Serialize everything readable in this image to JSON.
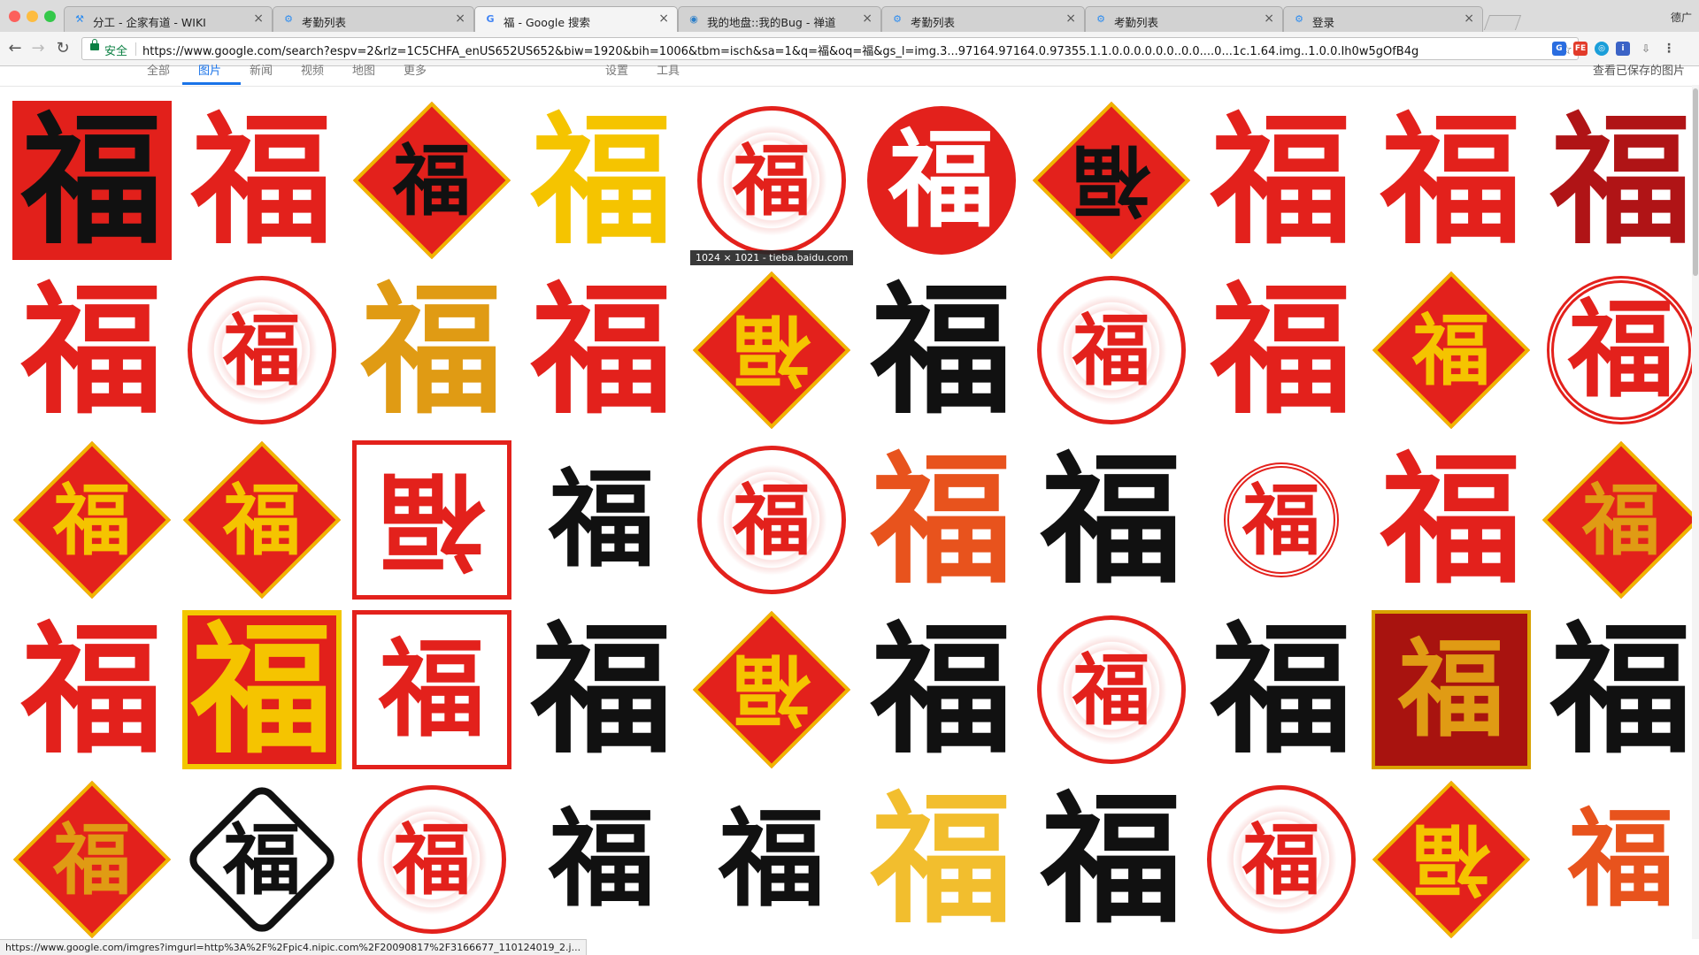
{
  "tabs": [
    {
      "label": "分工 - 企家有道 - WIKI",
      "icon": "wiki-icon",
      "icon_char": "⚒",
      "active": false
    },
    {
      "label": "考勤列表",
      "icon": "gear-icon",
      "icon_char": "⚙",
      "active": false
    },
    {
      "label": "福 - Google 搜索",
      "icon": "google-icon",
      "icon_char": "G",
      "active": true
    },
    {
      "label": "我的地盘::我的Bug - 禅道",
      "icon": "zentao-icon",
      "icon_char": "◉",
      "active": false
    },
    {
      "label": "考勤列表",
      "icon": "gear-icon",
      "icon_char": "⚙",
      "active": false
    },
    {
      "label": "考勤列表",
      "icon": "gear-icon",
      "icon_char": "⚙",
      "active": false
    },
    {
      "label": "登录",
      "icon": "gear-icon",
      "icon_char": "⚙",
      "active": false
    }
  ],
  "profile_label": "德广",
  "toolbar": {
    "back": "←",
    "forward": "→",
    "reload": "↻",
    "secure_label": "安全",
    "url": "https://www.google.com/search?espv=2&rlz=1C5CHFA_enUS652US652&biw=1920&bih=1006&tbm=isch&sa=1&q=福&oq=福&gs_l=img.3...97164.97164.0.97355.1.1.0.0.0.0.0.0..0.0....0...1c.1.64.img..1.0.0.Ih0w5gOfB4g",
    "star": "☆"
  },
  "google_nav": {
    "items": [
      "全部",
      "图片",
      "新闻",
      "视频",
      "地图",
      "更多",
      "设置",
      "工具"
    ],
    "active": "图片",
    "right_link": "查看已保存的图片"
  },
  "image_glyph": "福",
  "tooltip": "1024 × 1021 - tieba.baidu.com",
  "status_url": "https://www.google.com/imgres?imgurl=http%3A%2F%2Fpic4.nipic.com%2F20090817%2F3166677_110124019_2.j...",
  "colors": {
    "red": "#e3211c",
    "black": "#111111",
    "yellow": "#f5c400",
    "gold": "#e09b14",
    "orange": "#e8531d",
    "link_blue": "#1a73e8",
    "secure_green": "#0b8043"
  },
  "images": [
    {
      "style": "square",
      "glyph_color": "black"
    },
    {
      "style": "plain",
      "glyph_color": "red"
    },
    {
      "style": "diamond-red",
      "glyph_color": "black"
    },
    {
      "style": "plain",
      "glyph_color": "yellow"
    },
    {
      "style": "circle-outline",
      "glyph_color": "red"
    },
    {
      "style": "circle-fill",
      "glyph_color": "white"
    },
    {
      "style": "diamond-red-inv",
      "glyph_color": "black"
    },
    {
      "style": "plain",
      "glyph_color": "red"
    },
    {
      "style": "plain",
      "glyph_color": "red"
    },
    {
      "style": "plain",
      "glyph_color": "darkred"
    },
    {
      "style": "plain",
      "glyph_color": "red"
    },
    {
      "style": "circle-outline",
      "glyph_color": "red"
    },
    {
      "style": "plain",
      "glyph_color": "gold"
    },
    {
      "style": "plain",
      "glyph_color": "red"
    },
    {
      "style": "diamond-red-inv",
      "glyph_color": "yellow"
    },
    {
      "style": "plain",
      "glyph_color": "black"
    },
    {
      "style": "circle-outline",
      "glyph_color": "red"
    },
    {
      "style": "plain",
      "glyph_color": "red"
    },
    {
      "style": "diamond-red",
      "glyph_color": "yellow"
    },
    {
      "style": "circle-ring",
      "glyph_color": "red"
    },
    {
      "style": "diamond-red",
      "glyph_color": "yellow"
    },
    {
      "style": "diamond-red",
      "glyph_color": "yellow"
    },
    {
      "style": "square-outline-inv",
      "glyph_color": "red"
    },
    {
      "style": "plain-small",
      "glyph_color": "black"
    },
    {
      "style": "circle-outline",
      "glyph_color": "red"
    },
    {
      "style": "plain",
      "glyph_color": "orange"
    },
    {
      "style": "plain",
      "glyph_color": "black"
    },
    {
      "style": "circle-ring-small",
      "glyph_color": "red"
    },
    {
      "style": "plain",
      "glyph_color": "red"
    },
    {
      "style": "diamond-red",
      "glyph_color": "gold"
    },
    {
      "style": "plain",
      "glyph_color": "red"
    },
    {
      "style": "square-yellow",
      "glyph_color": "yellow"
    },
    {
      "style": "square-outline",
      "glyph_color": "red"
    },
    {
      "style": "plain",
      "glyph_color": "black"
    },
    {
      "style": "diamond-red-inv",
      "glyph_color": "yellow"
    },
    {
      "style": "plain",
      "glyph_color": "black"
    },
    {
      "style": "circle-outline",
      "glyph_color": "red"
    },
    {
      "style": "plain",
      "glyph_color": "black"
    },
    {
      "style": "dark-square",
      "glyph_color": "gold"
    },
    {
      "style": "plain",
      "glyph_color": "black"
    },
    {
      "style": "diamond-red",
      "glyph_color": "gold"
    },
    {
      "style": "diamond-outline",
      "glyph_color": "black"
    },
    {
      "style": "circle-outline",
      "glyph_color": "red"
    },
    {
      "style": "plain-small",
      "glyph_color": "black"
    },
    {
      "style": "plain-small",
      "glyph_color": "black"
    },
    {
      "style": "plain",
      "glyph_color": "gold2"
    },
    {
      "style": "plain",
      "glyph_color": "black"
    },
    {
      "style": "circle-outline",
      "glyph_color": "red"
    },
    {
      "style": "diamond-red-inv",
      "glyph_color": "yellow"
    },
    {
      "style": "plain-small",
      "glyph_color": "orange"
    }
  ]
}
